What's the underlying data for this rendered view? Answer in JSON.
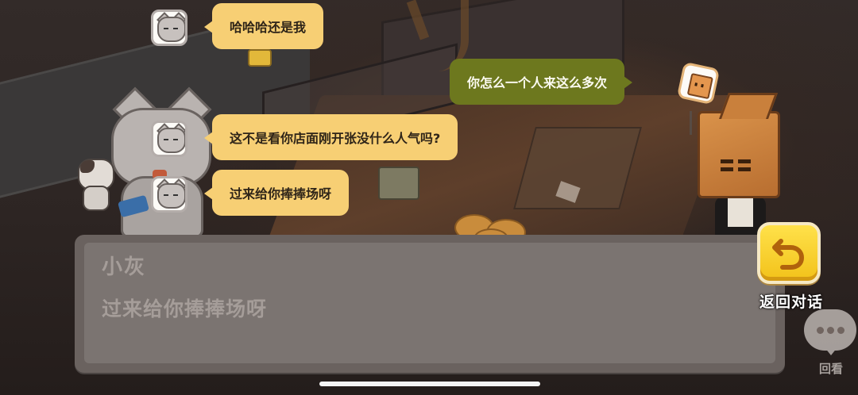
{
  "chat_log": [
    {
      "side": "left",
      "speaker_icon": "gray-cat-avatar-icon",
      "text": "哈哈哈还是我"
    },
    {
      "side": "right",
      "speaker_icon": "box-head-avatar-icon",
      "text": "你怎么一个人来这么多次"
    },
    {
      "side": "left",
      "speaker_icon": "gray-cat-avatar-icon",
      "text": "这不是看你店面刚开张没什么人气吗?"
    },
    {
      "side": "left",
      "speaker_icon": "gray-cat-avatar-icon",
      "text": "过来给你捧捧场呀"
    }
  ],
  "dialog": {
    "speaker_name": "小灰",
    "text": "过来给你捧捧场呀"
  },
  "controls": {
    "return_label": "返回对话",
    "return_icon": "return-arrow-icon",
    "review_label": "回看",
    "review_icon": "speech-bubble-dots-icon"
  },
  "colors": {
    "left_bubble": "#f7cf74",
    "right_bubble": "#6d781e",
    "dialog_bg": "#6a625f",
    "return_button": "#f2c21a"
  }
}
